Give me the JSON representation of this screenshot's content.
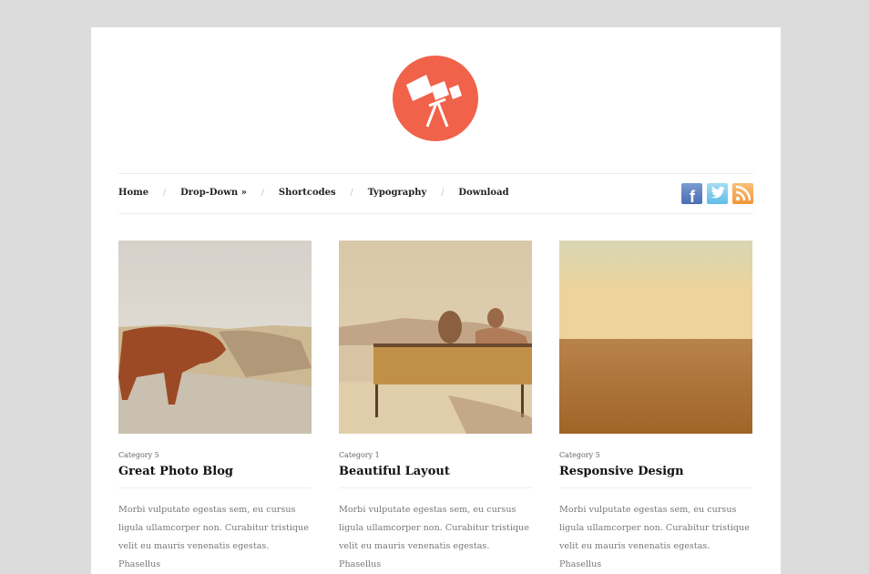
{
  "logo": {
    "icon": "telescope-icon",
    "color": "#f0624a"
  },
  "nav": {
    "items": [
      "Home",
      "Drop-Down »",
      "Shortcodes",
      "Typography",
      "Download"
    ],
    "separator": "/"
  },
  "social": [
    {
      "name": "facebook",
      "glyph": "f"
    },
    {
      "name": "twitter",
      "glyph": "t"
    },
    {
      "name": "rss",
      "glyph": "rss"
    }
  ],
  "posts": [
    {
      "category": "Category 5",
      "title": "Great Photo Blog",
      "excerpt": "Morbi vulputate egestas sem, eu cursus ligula ullamcorper non. Curabitur tristique velit eu mauris venenatis egestas. Phasellus",
      "image": "highland-cow"
    },
    {
      "category": "Category 1",
      "title": "Beautiful Layout",
      "excerpt": "Morbi vulputate egestas sem, eu cursus ligula ullamcorper non. Curabitur tristique velit eu mauris venenatis egestas. Phasellus",
      "image": "couple-on-bench"
    },
    {
      "category": "Category 5",
      "title": "Responsive Design",
      "excerpt": "Morbi vulputate egestas sem, eu cursus ligula ullamcorper non. Curabitur tristique velit eu mauris venenatis egestas. Phasellus",
      "image": "wheat-field"
    }
  ]
}
